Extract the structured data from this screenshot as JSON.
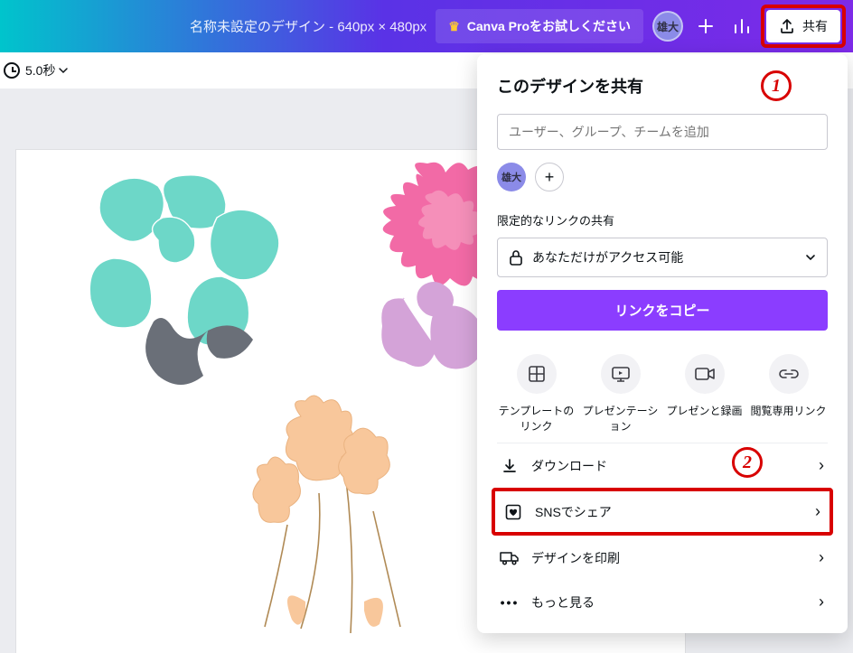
{
  "header": {
    "title": "名称未設定のデザイン - 640px × 480px",
    "pro_label": "Canva Proをお試しください",
    "avatar_initials": "雄大",
    "share_label": "共有"
  },
  "toolbar": {
    "duration": "5.0秒"
  },
  "share_panel": {
    "title": "このデザインを共有",
    "search_placeholder": "ユーザー、グループ、チームを追加",
    "owner_initials": "雄大",
    "link_section_label": "限定的なリンクの共有",
    "access_label": "あなただけがアクセス可能",
    "copy_link_label": "リンクをコピー",
    "tiles": [
      {
        "label": "テンプレートのリンク"
      },
      {
        "label": "プレゼンテーション"
      },
      {
        "label": "プレゼンと録画"
      },
      {
        "label": "閲覧専用リンク"
      }
    ],
    "rows": {
      "download": "ダウンロード",
      "sns": "SNSでシェア",
      "print": "デザインを印刷",
      "more": "もっと見る"
    }
  },
  "annotations": {
    "one": "1",
    "two": "2"
  },
  "colors": {
    "accent": "#8b3dff",
    "highlight": "#d80000"
  }
}
